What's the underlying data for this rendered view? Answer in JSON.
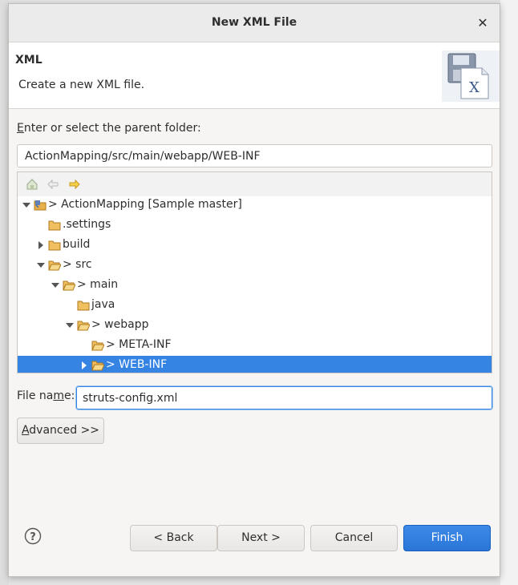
{
  "dialog": {
    "title": "New XML File",
    "close_glyph": "✕"
  },
  "banner": {
    "title": "XML",
    "description": "Create a new XML file.",
    "icon": "xml-file-wizard-icon"
  },
  "parent_folder": {
    "label_mnemonic": "E",
    "label_rest": "nter or select the parent folder:",
    "value": "ActionMapping/src/main/webapp/WEB-INF"
  },
  "tree_toolbar": {
    "icons": [
      "home-icon",
      "back-arrow-icon",
      "forward-arrow-icon"
    ]
  },
  "tree": {
    "rows": [
      {
        "label": "> ActionMapping [Sample master]",
        "expanded": true
      },
      {
        "label": ".settings"
      },
      {
        "label": "build",
        "expanded": false
      },
      {
        "label": "> src",
        "expanded": true
      },
      {
        "label": "> main",
        "expanded": true
      },
      {
        "label": "java"
      },
      {
        "label": "> webapp",
        "expanded": true
      },
      {
        "label": "> META-INF"
      },
      {
        "label": "> WEB-INF",
        "expanded": false,
        "selected": true
      }
    ]
  },
  "file_name": {
    "label_prefix": "File na",
    "label_mnemonic": "m",
    "label_suffix": "e:",
    "value": "struts-config.xml"
  },
  "buttons": {
    "advanced_mnemonic": "A",
    "advanced_rest": "dvanced >>",
    "back": "< Back",
    "next": "Next >",
    "cancel": "Cancel",
    "finish": "Finish"
  },
  "colors": {
    "accent": "#3584e4",
    "folder": "#e8b04a"
  }
}
